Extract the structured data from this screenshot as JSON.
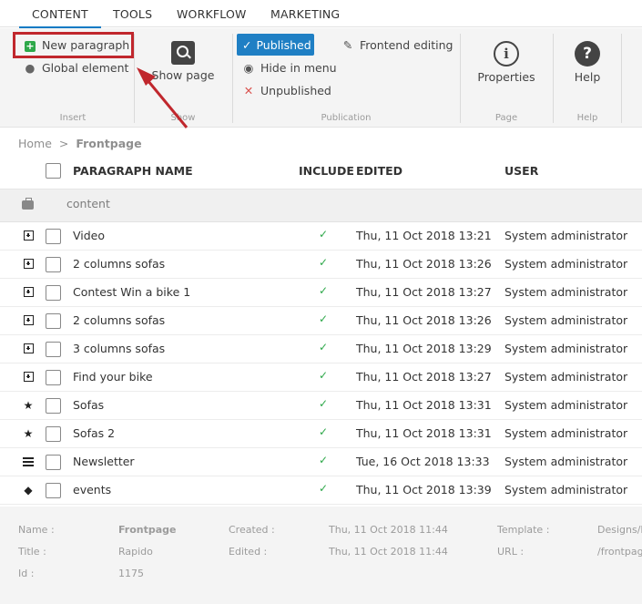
{
  "tabs": [
    "CONTENT",
    "TOOLS",
    "WORKFLOW",
    "MARKETING"
  ],
  "ribbon": {
    "insert": {
      "new_paragraph": "New paragraph",
      "global_element": "Global element",
      "group_label": "Insert"
    },
    "show": {
      "show_page": "Show page",
      "group_label": "Show"
    },
    "publication": {
      "published": "Published",
      "hide_in_menu": "Hide in menu",
      "unpublished": "Unpublished",
      "frontend_editing": "Frontend editing",
      "group_label": "Publication"
    },
    "page": {
      "properties": "Properties",
      "group_label": "Page"
    },
    "help": {
      "help": "Help",
      "group_label": "Help"
    }
  },
  "breadcrumb": {
    "home": "Home",
    "separator": ">",
    "current": "Frontpage"
  },
  "table": {
    "headers": {
      "name": "PARAGRAPH NAME",
      "include": "INCLUDE",
      "edited": "EDITED",
      "user": "USER"
    },
    "group": "content",
    "rows": [
      {
        "icon": "paragraph-icon",
        "name": "Video",
        "edited": "Thu, 11 Oct 2018 13:21",
        "user": "System administrator"
      },
      {
        "icon": "paragraph-icon",
        "name": "2 columns sofas",
        "edited": "Thu, 11 Oct 2018 13:26",
        "user": "System administrator"
      },
      {
        "icon": "paragraph-icon",
        "name": "Contest Win a bike 1",
        "edited": "Thu, 11 Oct 2018 13:27",
        "user": "System administrator"
      },
      {
        "icon": "paragraph-icon",
        "name": "2 columns sofas",
        "edited": "Thu, 11 Oct 2018 13:26",
        "user": "System administrator"
      },
      {
        "icon": "paragraph-icon",
        "name": "3 columns sofas",
        "edited": "Thu, 11 Oct 2018 13:29",
        "user": "System administrator"
      },
      {
        "icon": "paragraph-icon",
        "name": "Find your bike",
        "edited": "Thu, 11 Oct 2018 13:27",
        "user": "System administrator"
      },
      {
        "icon": "star-icon",
        "name": "Sofas",
        "edited": "Thu, 11 Oct 2018 13:31",
        "user": "System administrator"
      },
      {
        "icon": "star-icon",
        "name": "Sofas 2",
        "edited": "Thu, 11 Oct 2018 13:31",
        "user": "System administrator"
      },
      {
        "icon": "newsletter-icon",
        "name": "Newsletter",
        "edited": "Tue, 16 Oct 2018 13:33",
        "user": "System administrator"
      },
      {
        "icon": "layers-icon",
        "name": "events",
        "edited": "Thu, 11 Oct 2018 13:39",
        "user": "System administrator"
      }
    ]
  },
  "footer": {
    "name_label": "Name :",
    "name_value": "Frontpage",
    "title_label": "Title :",
    "title_value": "Rapido",
    "id_label": "Id :",
    "id_value": "1175",
    "created_label": "Created :",
    "created_value": "Thu, 11 Oct 2018 11:44",
    "edited_label": "Edited :",
    "edited_value": "Thu, 11 Oct 2018 11:44",
    "template_label": "Template :",
    "template_value": "Designs/R",
    "url_label": "URL :",
    "url_value": "/frontpage"
  },
  "colors": {
    "accent": "#1f7fc4",
    "highlight": "#c0272d",
    "check": "#2ea84a"
  }
}
